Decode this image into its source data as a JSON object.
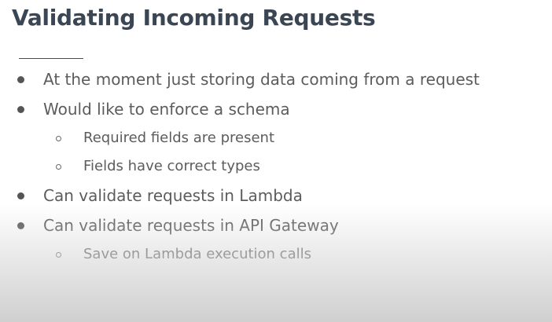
{
  "slide": {
    "title": "Validating Incoming Requests",
    "bullets": [
      {
        "level": 1,
        "text": "At the moment just storing data coming from a request"
      },
      {
        "level": 1,
        "text": "Would like to enforce a schema"
      },
      {
        "level": 2,
        "text": "Required fields are present"
      },
      {
        "level": 2,
        "text": "Fields have correct types"
      },
      {
        "level": 1,
        "text": "Can validate requests in Lambda"
      },
      {
        "level": 1,
        "text": "Can validate requests in API Gateway"
      },
      {
        "level": 2,
        "text": "Save on Lambda execution calls"
      }
    ]
  }
}
